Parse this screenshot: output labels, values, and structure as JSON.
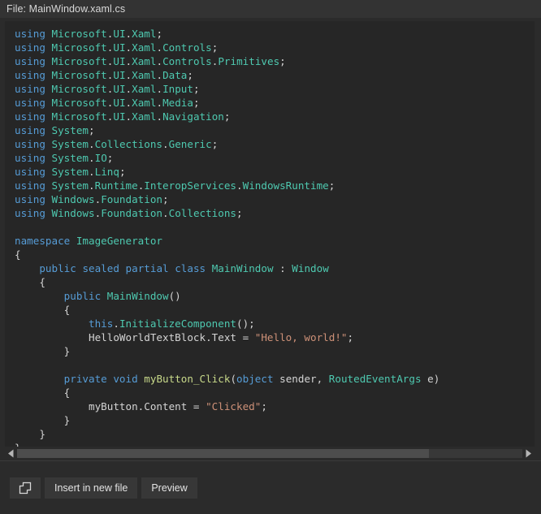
{
  "header": {
    "label_prefix": "File:",
    "filename": "MainWindow.xaml.cs",
    "title": "File: MainWindow.xaml.cs"
  },
  "editor": {
    "language": "csharp",
    "theme": "dark",
    "code_lines": [
      "using Microsoft.UI.Xaml;",
      "using Microsoft.UI.Xaml.Controls;",
      "using Microsoft.UI.Xaml.Controls.Primitives;",
      "using Microsoft.UI.Xaml.Data;",
      "using Microsoft.UI.Xaml.Input;",
      "using Microsoft.UI.Xaml.Media;",
      "using Microsoft.UI.Xaml.Navigation;",
      "using System;",
      "using System.Collections.Generic;",
      "using System.IO;",
      "using System.Linq;",
      "using System.Runtime.InteropServices.WindowsRuntime;",
      "using Windows.Foundation;",
      "using Windows.Foundation.Collections;",
      "",
      "namespace ImageGenerator",
      "{",
      "    public sealed partial class MainWindow : Window",
      "    {",
      "        public MainWindow()",
      "        {",
      "            this.InitializeComponent();",
      "            HelloWorldTextBlock.Text = \"Hello, world!\";",
      "        }",
      "",
      "        private void myButton_Click(object sender, RoutedEventArgs e)",
      "        {",
      "            myButton.Content = \"Clicked\";",
      "        }",
      "    }",
      "}"
    ],
    "colors": {
      "background": "#262626",
      "foreground": "#d4d4d4",
      "keyword": "#569cd6",
      "type": "#4ec9b0",
      "method": "#c8d98a",
      "string": "#ce9178",
      "panel_outer": "#2b2b2b"
    }
  },
  "scrollbar": {
    "orientation": "horizontal",
    "left_arrow": "◀",
    "right_arrow": "▶",
    "thumb_percent": "81.5%"
  },
  "actions": {
    "copy_label": "",
    "copy_icon": "copy-icon",
    "insert_label": "Insert in new file",
    "preview_label": "Preview"
  }
}
